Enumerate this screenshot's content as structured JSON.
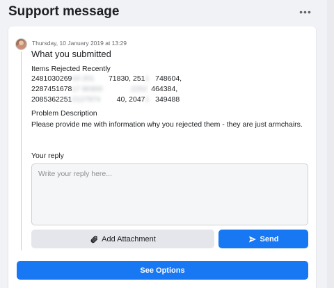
{
  "header": {
    "title": "Support message",
    "more_label": "•••"
  },
  "message": {
    "timestamp": "Thursday, 10 January 2019 at 13:29",
    "title": "What you submitted",
    "items_label": "Items Rejected Recently",
    "items_rows": [
      {
        "visible_start": "2481030269",
        "blurred": "  10 201  ",
        "visible_mid": "71830, 251",
        "blurred2": "  1",
        "visible_end": "748604,"
      },
      {
        "visible_start": "2287451678",
        "blurred": "  17 80300  ",
        "visible_mid": "",
        "blurred2": "  2252  ",
        "visible_end": "464384,"
      },
      {
        "visible_start": "2085362251",
        "blurred": "  2127974  ",
        "visible_mid": "40, 2047",
        "blurred2": "  1",
        "visible_end": "349488"
      }
    ],
    "problem_label": "Problem Description",
    "problem_text": "Please provide me with information why you rejected them - they are just armchairs."
  },
  "reply": {
    "label": "Your reply",
    "placeholder": "Write your reply here..."
  },
  "buttons": {
    "attach_label": "Add Attachment",
    "send_label": "Send",
    "see_options_label": "See Options"
  },
  "colors": {
    "primary": "#1877f2",
    "secondary": "#e4e6eb",
    "background": "#f0f2f5"
  },
  "icons": {
    "attach": "paperclip-icon",
    "send": "send-icon",
    "more": "more-options-icon"
  }
}
